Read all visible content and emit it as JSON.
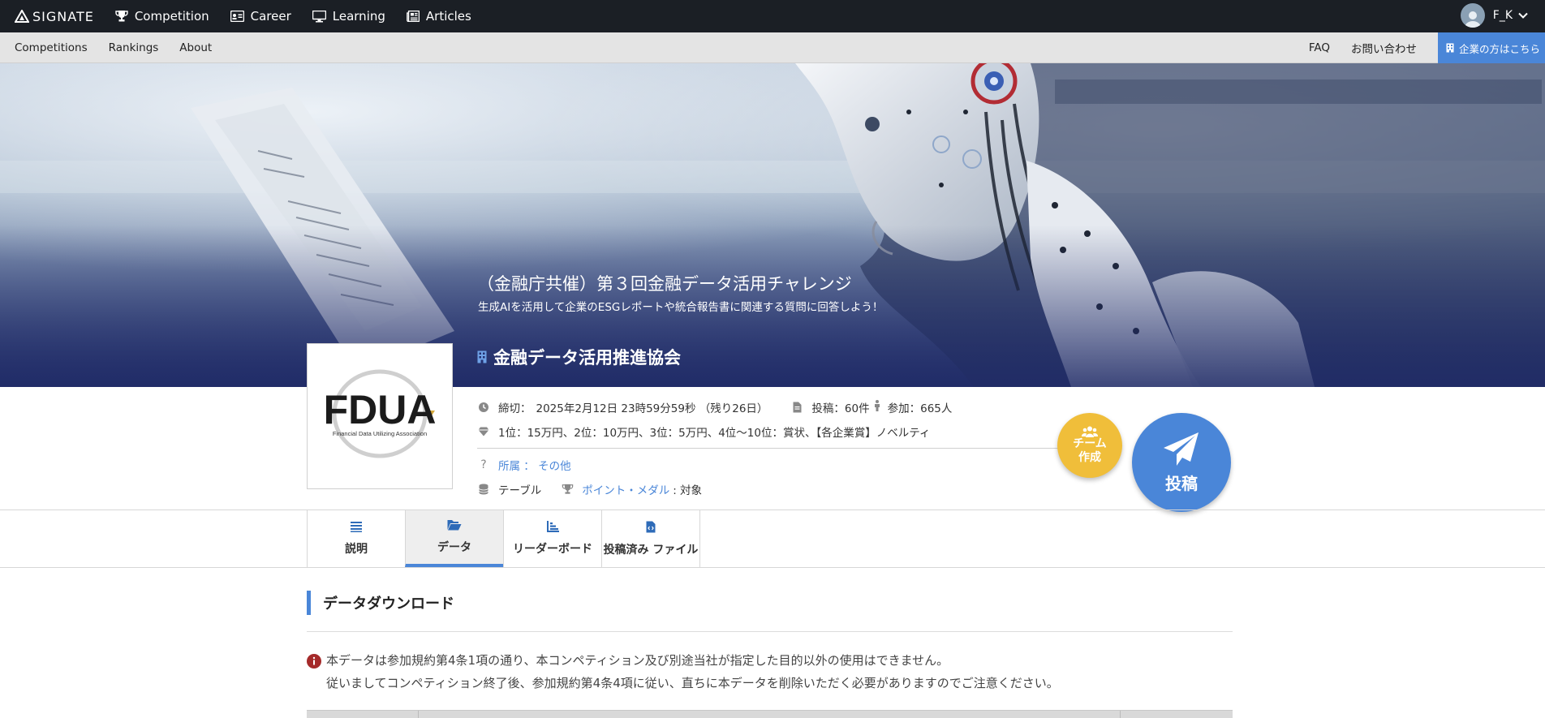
{
  "topnav": {
    "brand": "SIGNATE",
    "items": [
      {
        "label": "Competition",
        "icon": "trophy-icon"
      },
      {
        "label": "Career",
        "icon": "id-card-icon"
      },
      {
        "label": "Learning",
        "icon": "monitor-icon"
      },
      {
        "label": "Articles",
        "icon": "newspaper-icon"
      }
    ],
    "user": "F_K"
  },
  "subnav": {
    "left": [
      "Competitions",
      "Rankings",
      "About"
    ],
    "faq": "FAQ",
    "contact": "お問い合わせ",
    "corporate": "企業の方はこちら"
  },
  "hero": {
    "title": "（金融庁共催）第３回金融データ活用チャレンジ",
    "subtitle": "生成AIを活用して企業のESGレポートや統合報告書に関連する質問に回答しよう！",
    "organizer": "金融データ活用推進協会"
  },
  "logo": {
    "text": "FDUA",
    "caption": "Financial Data Utilizing Association"
  },
  "info": {
    "deadline_label": "締切：",
    "deadline_value": "2025年2月12日 23時59分59秒 （残り26日）",
    "submissions": "投稿：60件",
    "participants": "参加：665人",
    "prizes": "1位：15万円、2位：10万円、3位：5万円、4位〜10位：賞状、【各企業賞】ノベルティ",
    "affiliation": "所属 ： その他",
    "data_type": "テーブル",
    "points_link": "ポイント・メダル",
    "points_value": ": 対象"
  },
  "actions": {
    "team_line1": "チーム",
    "team_line2": "作成",
    "post": "投稿"
  },
  "tabs": [
    {
      "label": "説明",
      "active": false
    },
    {
      "label": "データ",
      "active": true
    },
    {
      "label": "リーダーボード",
      "active": false
    },
    {
      "label": "投稿済み ファイル",
      "active": false
    }
  ],
  "content": {
    "section_title": "データダウンロード",
    "notice_line1": "本データは参加規約第4条1項の通り、本コンペティション及び別途当社が指定した目的以外の使用はできません。",
    "notice_line2": "従いましてコンペティション終了後、参加規約第4条4項に従い、直ちに本データを削除いただく必要がありますのでご注意ください。"
  },
  "colors": {
    "accent": "#4a86d8",
    "team": "#f0be3a",
    "topbar": "#1b1f25",
    "notice_icon": "#c0392b"
  }
}
